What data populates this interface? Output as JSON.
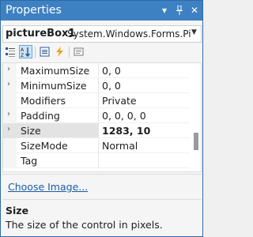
{
  "window": {
    "title": "Properties"
  },
  "object_selector": {
    "name": "pictureBox1",
    "type": "System.Windows.Forms.Pictu"
  },
  "toolbar": {
    "buttons": [
      {
        "name": "categorized-icon",
        "active": false
      },
      {
        "name": "alphabetical-icon",
        "active": true
      },
      {
        "name": "properties-icon",
        "active": false
      },
      {
        "name": "events-icon",
        "active": false
      },
      {
        "name": "property-pages-icon",
        "active": false
      }
    ]
  },
  "properties": [
    {
      "name": "MaximumSize",
      "value": "0, 0",
      "expandable": true,
      "selected": false
    },
    {
      "name": "MinimumSize",
      "value": "0, 0",
      "expandable": true,
      "selected": false
    },
    {
      "name": "Modifiers",
      "value": "Private",
      "expandable": false,
      "selected": false
    },
    {
      "name": "Padding",
      "value": "0, 0, 0, 0",
      "expandable": true,
      "selected": false
    },
    {
      "name": "Size",
      "value": "1283, 10",
      "expandable": true,
      "selected": true
    },
    {
      "name": "SizeMode",
      "value": "Normal",
      "expandable": false,
      "selected": false
    },
    {
      "name": "Tag",
      "value": "",
      "expandable": false,
      "selected": false
    }
  ],
  "commands": {
    "choose_image": "Choose Image..."
  },
  "description": {
    "title": "Size",
    "text": "The size of the control in pixels."
  },
  "colors": {
    "titlebar": "#3e81c2",
    "link": "#1a5ea8",
    "selected_row": "#e3e3e3"
  }
}
